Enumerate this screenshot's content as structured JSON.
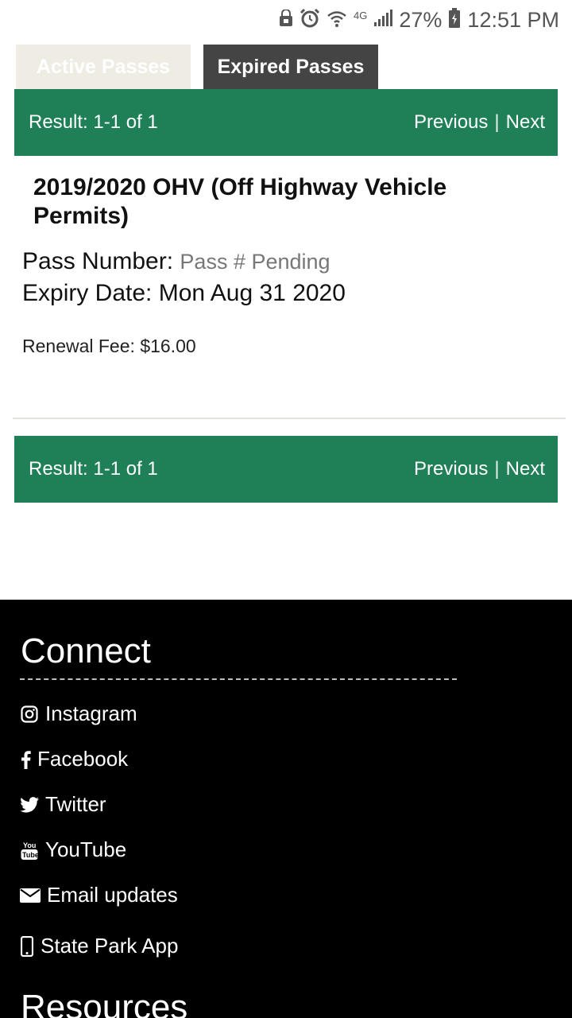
{
  "status_bar": {
    "network": "4G",
    "battery": "27%",
    "time": "12:51 PM"
  },
  "tabs": [
    {
      "label": "Active Passes"
    },
    {
      "label": "Expired Passes"
    }
  ],
  "results": {
    "summary": "Result: 1-1 of 1",
    "previous": "Previous",
    "separator": "|",
    "next": "Next"
  },
  "pass": {
    "title": "2019/2020 OHV (Off Highway Vehicle Permits)",
    "number_label": "Pass Number:",
    "number_value": "Pass # Pending",
    "expiry_label": "Expiry Date:",
    "expiry_value": "Mon Aug 31 2020",
    "renewal_label": "Renewal Fee:",
    "renewal_value": "$16.00"
  },
  "footer": {
    "connect_heading": "Connect",
    "links": [
      {
        "icon": "instagram-icon",
        "label": "Instagram"
      },
      {
        "icon": "facebook-icon",
        "label": "Facebook"
      },
      {
        "icon": "twitter-icon",
        "label": "Twitter"
      },
      {
        "icon": "youtube-icon",
        "label": "YouTube"
      },
      {
        "icon": "email-icon",
        "label": "Email updates"
      },
      {
        "icon": "phone-icon",
        "label": "State Park App"
      }
    ],
    "resources_heading": "Resources"
  },
  "colors": {
    "result_bar": "#1f7f56",
    "tab_inactive": "#efede3",
    "tab_selected": "#444444",
    "footer_bg": "#000000"
  }
}
